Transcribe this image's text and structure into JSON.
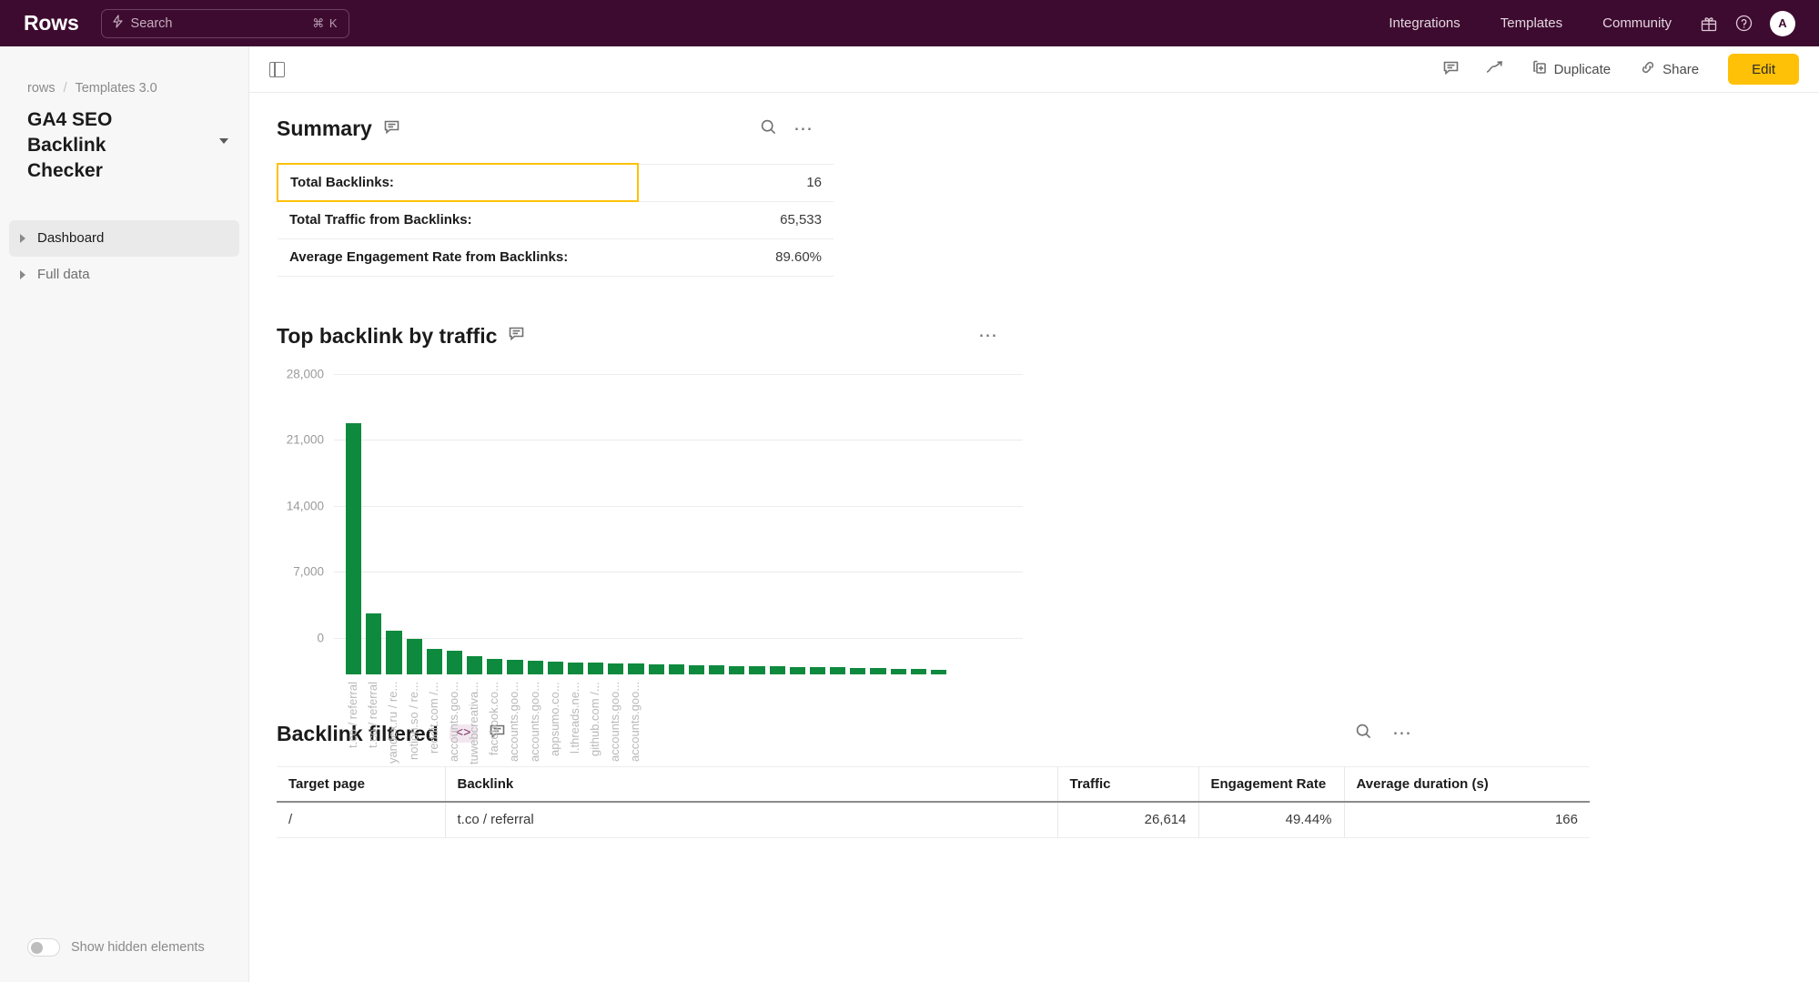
{
  "topbar": {
    "brand": "Rows",
    "search": {
      "placeholder": "Search",
      "shortcut": "⌘ K",
      "icon": "lightning-search-icon"
    },
    "links": [
      {
        "label": "Integrations",
        "name": "nav-integrations"
      },
      {
        "label": "Templates",
        "name": "nav-templates"
      },
      {
        "label": "Community",
        "name": "nav-community"
      }
    ],
    "icons": [
      "gift-icon",
      "help-icon"
    ],
    "avatar_initial": "A",
    "bg_color": "#3E0B30"
  },
  "sidebar": {
    "breadcrumb": {
      "workspace": "rows",
      "separator": "/",
      "folder": "Templates 3.0"
    },
    "doc_title": "GA4 SEO Backlink Checker",
    "items": [
      {
        "label": "Dashboard",
        "active": true
      },
      {
        "label": "Full data",
        "active": false
      }
    ],
    "footer_toggle": {
      "label": "Show hidden elements",
      "checked": false
    }
  },
  "content_header": {
    "panel_toggle_icon": "sidebar-panel-icon",
    "comment_icon": "comment-icon",
    "insights_icon": "trending-up-icon",
    "duplicate_label": "Duplicate",
    "share_label": "Share",
    "edit_label": "Edit",
    "edit_color": "#FFC107"
  },
  "summary": {
    "title": "Summary",
    "rows": [
      {
        "key": "Total Backlinks:",
        "value": "16",
        "selected": true
      },
      {
        "key": "Total Traffic from Backlinks:",
        "value": "65,533",
        "selected": false
      },
      {
        "key": "Average Engagement Rate from Backlinks:",
        "value": "89.60%",
        "selected": false
      }
    ]
  },
  "chart_block": {
    "title": "Top backlink by traffic"
  },
  "chart_data": {
    "type": "bar",
    "title": "Top backlink by traffic",
    "xlabel": "",
    "ylabel": "",
    "ylim": [
      0,
      28000
    ],
    "yticks": [
      0,
      7000,
      14000,
      21000,
      28000
    ],
    "ytick_labels": [
      "0",
      "7,000",
      "14,000",
      "21,000",
      "28,000"
    ],
    "grid": true,
    "legend": false,
    "bar_color": "#0E8A3E",
    "categories": [
      "t.co / referral",
      "t.co / referral",
      "yandex.ru / re...",
      "notion.so / re...",
      "reddit.com /...",
      "accounts.goo...",
      "tuwebcreativa...",
      "facebook.co...",
      "accounts.goo...",
      "accounts.goo...",
      "appsumo.co...",
      "l.threads.ne...",
      "github.com /...",
      "accounts.goo...",
      "accounts.goo...",
      "",
      "",
      "",
      "",
      "",
      "",
      "",
      "",
      "",
      "",
      "",
      "",
      "",
      "",
      ""
    ],
    "values": [
      26614,
      6400,
      4600,
      3700,
      2700,
      2500,
      1900,
      1550,
      1500,
      1400,
      1300,
      1250,
      1200,
      1150,
      1100,
      1050,
      1000,
      950,
      900,
      870,
      830,
      790,
      760,
      720,
      690,
      660,
      620,
      580,
      520,
      420
    ]
  },
  "backlink_table": {
    "title": "Backlink filtered",
    "code_badge": "<>",
    "columns": [
      "Target page",
      "Backlink",
      "Traffic",
      "Engagement Rate",
      "Average duration (s)"
    ],
    "rows": [
      {
        "target_page": "/",
        "backlink": "t.co / referral",
        "traffic": "26,614",
        "engagement_rate": "49.44%",
        "average_duration": "166"
      }
    ]
  }
}
